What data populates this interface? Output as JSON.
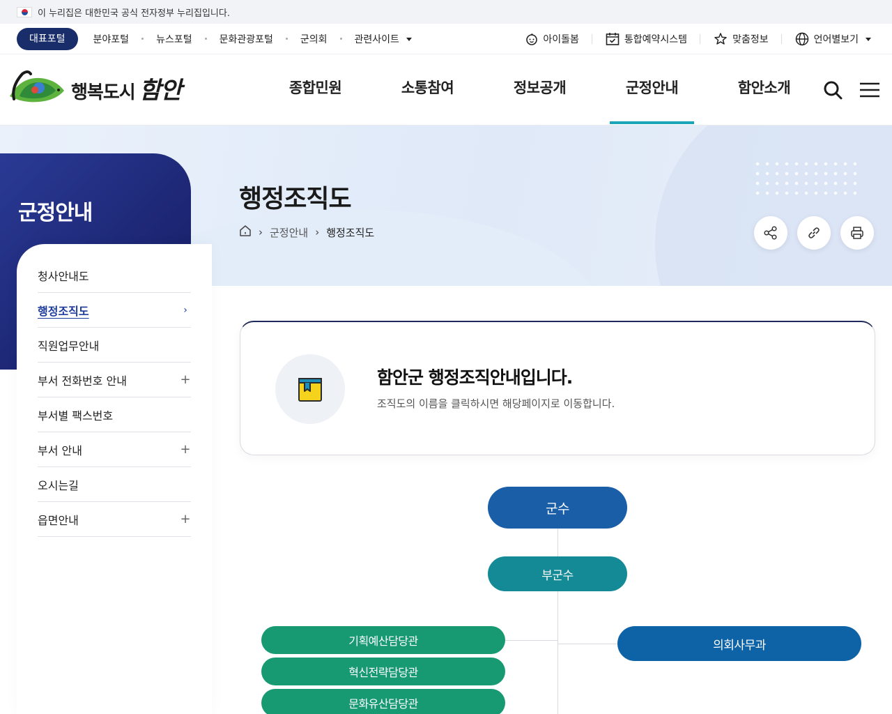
{
  "gov_banner": {
    "text": "이 누리집은 대한민국 공식 전자정부 누리집입니다."
  },
  "portal": {
    "main": "대표포털",
    "links": [
      "분야포털",
      "뉴스포털",
      "문화관광포털",
      "군의회",
      "관련사이트"
    ],
    "utils": [
      "아이돌봄",
      "통합예약시스템",
      "맞춤정보",
      "언어별보기"
    ]
  },
  "header": {
    "logo_text": "행복도시",
    "logo_script": "함안",
    "gnb": [
      "종합민원",
      "소통참여",
      "정보공개",
      "군정안내",
      "함안소개"
    ],
    "active_menu": "군정안내"
  },
  "visual": {
    "page_title": "행정조직도",
    "breadcrumb": [
      "군정안내",
      "행정조직도"
    ]
  },
  "sidebar": {
    "title": "군정안내",
    "items": [
      {
        "label": "청사안내도",
        "symbol": ""
      },
      {
        "label": "행정조직도",
        "symbol": "›"
      },
      {
        "label": "직원업무안내",
        "symbol": ""
      },
      {
        "label": "부서 전화번호 안내",
        "symbol": "+"
      },
      {
        "label": "부서별 팩스번호",
        "symbol": ""
      },
      {
        "label": "부서 안내",
        "symbol": "+"
      },
      {
        "label": "오시는길",
        "symbol": ""
      },
      {
        "label": "읍면안내",
        "symbol": "+"
      }
    ]
  },
  "info": {
    "title": "함안군 행정조직안내입니다.",
    "desc": "조직도의 이름을 클릭하시면 해당페이지로 이동합니다."
  },
  "org": {
    "gunsu": "군수",
    "bugunsu": "부군수",
    "left": [
      "기획예산담당관",
      "혁신전략담당관",
      "문화유산담당관"
    ],
    "right": [
      "의회사무과"
    ]
  },
  "colors": {
    "navy": "#1a2d6b",
    "accent_teal": "#1ba5b8",
    "gunsu": "#1a5ea8",
    "bugunsu": "#138a96",
    "dept_green": "#179a72",
    "council_blue": "#0e63a6"
  }
}
